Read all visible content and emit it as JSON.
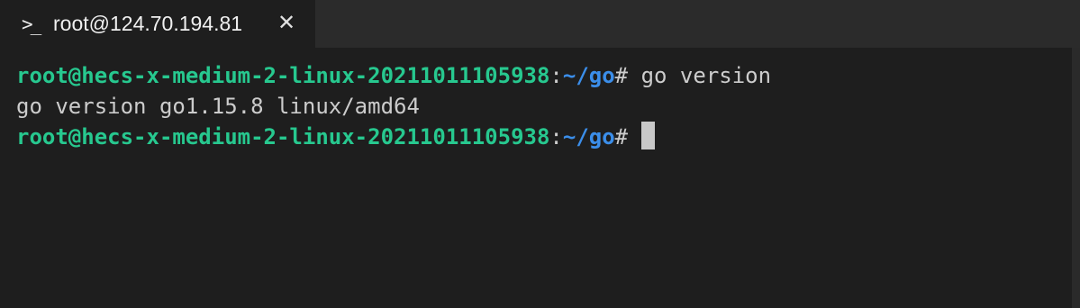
{
  "tab": {
    "icon": "terminal-prompt-icon",
    "icon_glyph": ">_",
    "title": "root@124.70.194.81",
    "close_glyph": "✕"
  },
  "colors": {
    "background": "#1e1e1e",
    "tabbar": "#2b2b2b",
    "user_host": "#27c88f",
    "path": "#3b8eea",
    "text": "#cccccc",
    "cursor": "#c8c8c8"
  },
  "terminal": {
    "lines": [
      {
        "user_host": "root@hecs-x-medium-2-linux-20211011105938",
        "sep": ":",
        "path": "~/go",
        "prompt": "# ",
        "command": "go version"
      },
      {
        "output": "go version go1.15.8 linux/amd64"
      },
      {
        "user_host": "root@hecs-x-medium-2-linux-20211011105938",
        "sep": ":",
        "path": "~/go",
        "prompt": "# ",
        "command": ""
      }
    ]
  }
}
